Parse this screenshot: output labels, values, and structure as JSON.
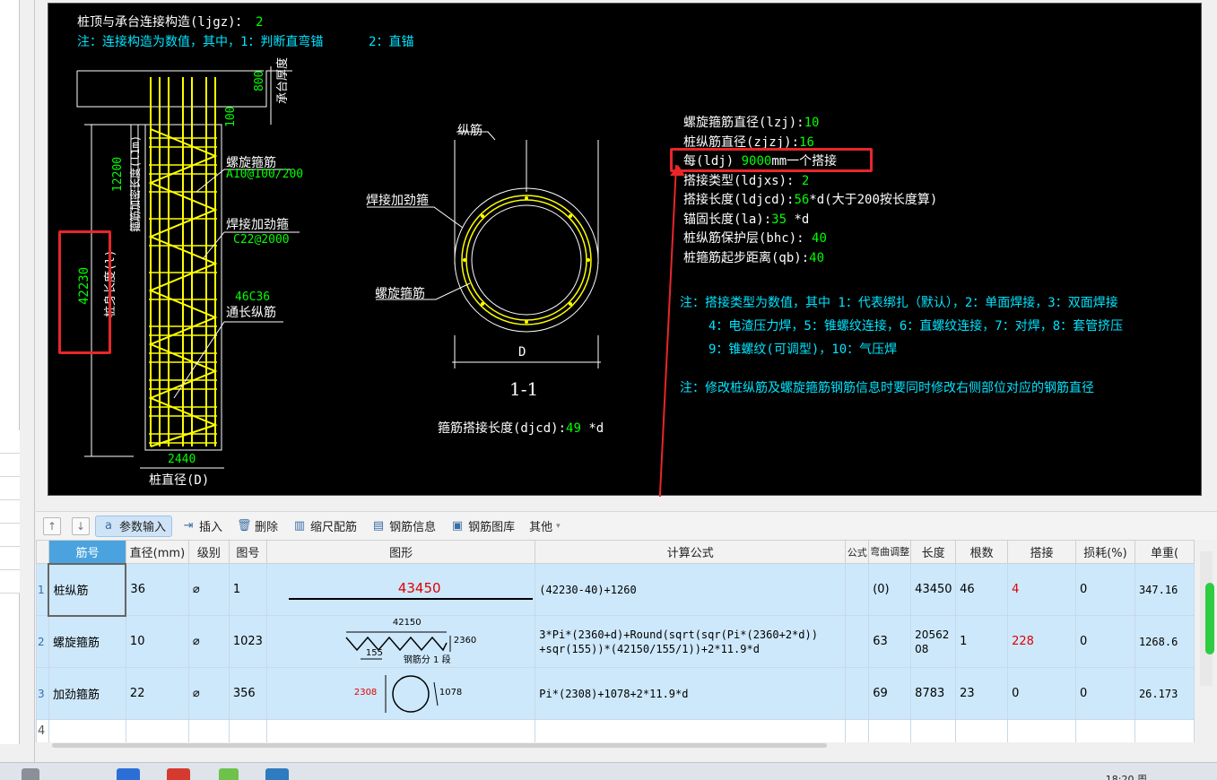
{
  "cad": {
    "line1_label": "桩顶与承台连接构造(ljgz)：",
    "line1_value": "2",
    "line2": "注：连接构造为数值，其中，1：判断直弯锚",
    "line2b": "2：直锚",
    "dim_800": "800",
    "dim_cap": "承台厚度",
    "dim_100": "100",
    "dim_12200": "12200",
    "dim_dense": "箍筋加密长度(l1m)",
    "dim_42230": "42230",
    "dim_pile_len": "桩身长度(l)",
    "lbl_spiral": "螺旋箍筋",
    "val_spiral": "A10@100/200",
    "lbl_weld": "焊接加劲箍",
    "val_weld": "C22@2000",
    "val_long": "46C36",
    "lbl_long": "通长纵筋",
    "dim_2440": "2440",
    "lbl_diameter": "桩直径(D)",
    "sec_long": "纵筋",
    "sec_weld": "焊接加劲箍",
    "sec_spiral": "螺旋箍筋",
    "sec_D": "D",
    "sec_title": "1-1",
    "djcd_label": "箍筋搭接长度(djcd):",
    "djcd_value": "49",
    "djcd_unit": "*d",
    "info": [
      {
        "label": "螺旋箍筋直径(lzj):",
        "value": "10",
        "suffix": ""
      },
      {
        "label": "桩纵筋直径(zjzj):",
        "value": "16",
        "suffix": ""
      },
      {
        "label": "每(ldj)",
        "value": "9000",
        "suffix": "mm一个搭接"
      },
      {
        "label": "搭接类型(ldjxs):",
        "value": "2",
        "suffix": ""
      },
      {
        "label": "搭接长度(ldjcd):",
        "value": "56",
        "suffix": "*d(大于200按长度算)"
      },
      {
        "label": "锚固长度(la):",
        "value": "35",
        "suffix": "*d"
      },
      {
        "label": "桩纵筋保护层(bhc):",
        "value": "40",
        "suffix": ""
      },
      {
        "label": "桩箍筋起步距离(qb):",
        "value": "40",
        "suffix": ""
      }
    ],
    "note1": "注：搭接类型为数值，其中 1：代表绑扎（默认），2：单面焊接，3：双面焊接",
    "note2": "4：电渣压力焊，5：锥螺纹连接，6：直螺纹连接，7：对焊，8：套管挤压",
    "note3": "9：锥螺纹(可调型)，10：气压焊",
    "note4": "注：修改桩纵筋及螺旋箍筋钢筋信息时要同时修改右侧部位对应的钢筋直径"
  },
  "toolbar": {
    "param": "参数输入",
    "insert": "插入",
    "delete": "删除",
    "scale": "缩尺配筋",
    "info": "钢筋信息",
    "lib": "钢筋图库",
    "other": "其他"
  },
  "grid": {
    "headers": [
      "筋号",
      "直径(mm)",
      "级别",
      "图号",
      "图形",
      "计算公式",
      "公式",
      "弯曲调整",
      "长度",
      "根数",
      "搭接",
      "损耗(%)",
      "单重("
    ],
    "rows": [
      {
        "no": "1",
        "name": "桩纵筋",
        "dia": "36",
        "grade": "⌀",
        "fig": "1",
        "shape_val": "43450",
        "formula": "(42230-40)+1260",
        "bend": "(0)",
        "len": "43450",
        "count": "46",
        "lap": "4",
        "loss": "0",
        "unit": "347.16"
      },
      {
        "no": "2",
        "name": "螺旋箍筋",
        "dia": "10",
        "grade": "⌀",
        "fig": "1023",
        "shape_top": "42150",
        "shape_right": "2360",
        "shape_left": "155",
        "shape_note": "钢筋分 1 段",
        "formula": "3*Pi*(2360+d)+Round(sqrt(sqr(Pi*(2360+2*d))",
        "formula2": "+sqr(155))*(42150/155/1))+2*11.9*d",
        "bend": "63",
        "len": "20562\n08",
        "count": "1",
        "lap": "228",
        "loss": "0",
        "unit": "1268.6"
      },
      {
        "no": "3",
        "name": "加劲箍筋",
        "dia": "22",
        "grade": "⌀",
        "fig": "356",
        "shape_left": "2308",
        "shape_right": "1078",
        "formula": "Pi*(2308)+1078+2*11.9*d",
        "bend": "69",
        "len": "8783",
        "count": "23",
        "lap": "0",
        "loss": "0",
        "unit": "26.173"
      },
      {
        "no": "4"
      }
    ]
  },
  "taskbar": {
    "clock": "18:20 周"
  }
}
